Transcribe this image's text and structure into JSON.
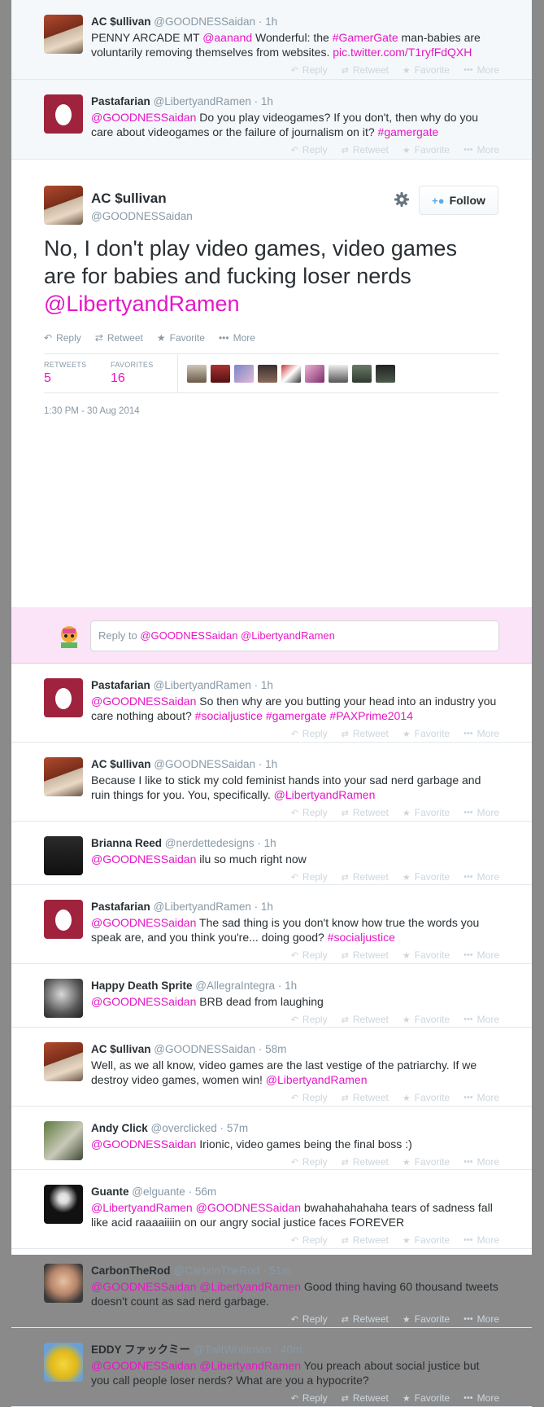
{
  "colors": {
    "link": "#e616c6",
    "muted": "#8899a6",
    "reply_bar": "#fbe4f7"
  },
  "actions": {
    "reply": "Reply",
    "retweet": "Retweet",
    "favorite": "Favorite",
    "more": "More"
  },
  "previous_tweets": [
    {
      "name": "AC $ullivan",
      "handle": "@GOODNESSaidan",
      "time": "1h",
      "parts": [
        {
          "t": "text",
          "v": "PENNY ARCADE MT "
        },
        {
          "t": "mention",
          "v": "@aanand"
        },
        {
          "t": "text",
          "v": " Wonderful: the "
        },
        {
          "t": "hashtag",
          "v": "#GamerGate"
        },
        {
          "t": "text",
          "v": " man-babies are voluntarily removing themselves from websites. "
        },
        {
          "t": "link",
          "v": "pic.twitter.com/T1ryfFdQXH"
        }
      ]
    },
    {
      "name": "Pastafarian",
      "handle": "@LibertyandRamen",
      "time": "1h",
      "parts": [
        {
          "t": "mention",
          "v": "@GOODNESSaidan"
        },
        {
          "t": "text",
          "v": " Do you play videogames? If you don't, then why do you care about videogames or the failure of journalism on it? "
        },
        {
          "t": "hashtag",
          "v": "#gamergate"
        }
      ]
    }
  ],
  "main_tweet": {
    "name": "AC $ullivan",
    "handle": "@GOODNESSaidan",
    "follow_label": "Follow",
    "text": "No, I don't play video games, video games are for babies and fucking loser nerds ",
    "mention": "@LibertyandRamen",
    "retweets_label": "RETWEETS",
    "retweets": "5",
    "favorites_label": "FAVORITES",
    "favorites": "16",
    "date": "1:30 PM - 30 Aug 2014"
  },
  "reply_box": {
    "prefix": "Reply to ",
    "mentions": "@GOODNESSaidan @LibertyandRamen"
  },
  "replies": [
    {
      "name": "Pastafarian",
      "handle": "@LibertyandRamen",
      "time": "1h",
      "parts": [
        {
          "t": "mention",
          "v": "@GOODNESSaidan"
        },
        {
          "t": "text",
          "v": " So then why are you butting your head into an industry you care nothing about? "
        },
        {
          "t": "hashtag",
          "v": "#socialjustice"
        },
        {
          "t": "text",
          "v": " "
        },
        {
          "t": "hashtag",
          "v": "#gamergate"
        },
        {
          "t": "text",
          "v": " "
        },
        {
          "t": "hashtag",
          "v": "#PAXPrime2014"
        }
      ]
    },
    {
      "name": "AC $ullivan",
      "handle": "@GOODNESSaidan",
      "time": "1h",
      "parts": [
        {
          "t": "text",
          "v": "Because I like to stick my cold feminist hands into your sad nerd garbage and ruin things for you. You, specifically. "
        },
        {
          "t": "mention",
          "v": "@LibertyandRamen"
        }
      ]
    },
    {
      "name": "Brianna Reed",
      "handle": "@nerdettedesigns",
      "time": "1h",
      "parts": [
        {
          "t": "mention",
          "v": "@GOODNESSaidan"
        },
        {
          "t": "text",
          "v": " ilu so much right now"
        }
      ]
    },
    {
      "name": "Pastafarian",
      "handle": "@LibertyandRamen",
      "time": "1h",
      "parts": [
        {
          "t": "mention",
          "v": "@GOODNESSaidan"
        },
        {
          "t": "text",
          "v": " The sad thing is you don't know how true the words you speak are, and you think you're... doing good? "
        },
        {
          "t": "hashtag",
          "v": "#socialjustice"
        }
      ]
    },
    {
      "name": "Happy Death Sprite",
      "handle": "@AllegraIntegra",
      "time": "1h",
      "parts": [
        {
          "t": "mention",
          "v": "@GOODNESSaidan"
        },
        {
          "t": "text",
          "v": " BRB dead from laughing"
        }
      ]
    },
    {
      "name": "AC $ullivan",
      "handle": "@GOODNESSaidan",
      "time": "58m",
      "parts": [
        {
          "t": "text",
          "v": "Well, as we all know, video games are the last vestige of the patriarchy. If we destroy video games, women win! "
        },
        {
          "t": "mention",
          "v": "@LibertyandRamen"
        }
      ]
    },
    {
      "name": "Andy Click",
      "handle": "@overclicked",
      "time": "57m",
      "parts": [
        {
          "t": "mention",
          "v": "@GOODNESSaidan"
        },
        {
          "t": "text",
          "v": " Irionic, video games being the final boss :)"
        }
      ]
    },
    {
      "name": "Guante",
      "handle": "@elguante",
      "time": "56m",
      "parts": [
        {
          "t": "mention",
          "v": "@LibertyandRamen"
        },
        {
          "t": "text",
          "v": " "
        },
        {
          "t": "mention",
          "v": "@GOODNESSaidan"
        },
        {
          "t": "text",
          "v": " bwahahahahaha tears of sadness fall like acid raaaaiiiin on our angry social justice faces FOREVER"
        }
      ]
    },
    {
      "name": "CarbonTheRod",
      "handle": "@CarbonTheRod",
      "time": "51m",
      "parts": [
        {
          "t": "mention",
          "v": "@GOODNESSaidan"
        },
        {
          "t": "text",
          "v": " "
        },
        {
          "t": "mention",
          "v": "@LibertyandRamen"
        },
        {
          "t": "text",
          "v": " Good thing having 60 thousand tweets doesn't count as sad nerd garbage."
        }
      ]
    },
    {
      "name": "EDDY ファックミー",
      "handle": "@TwitWootman",
      "time": "40m",
      "parts": [
        {
          "t": "mention",
          "v": "@GOODNESSaidan"
        },
        {
          "t": "text",
          "v": " "
        },
        {
          "t": "mention",
          "v": "@LibertyandRamen"
        },
        {
          "t": "text",
          "v": " You preach about social justice but you call people loser nerds? What are you a hypocrite?"
        }
      ]
    }
  ]
}
